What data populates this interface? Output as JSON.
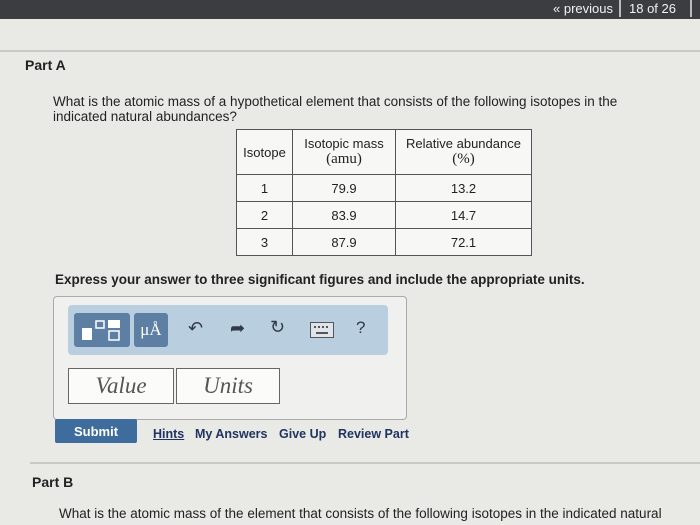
{
  "nav": {
    "previous_label": "« previous",
    "position": "18 of 26"
  },
  "part_a": {
    "title": "Part A",
    "question_line1": "What is the atomic mass of a hypothetical element that consists of the following isotopes in the",
    "question_line2": "indicated natural abundances?",
    "table": {
      "headers": {
        "isotope": "Isotope",
        "mass_line1": "Isotopic mass",
        "mass_line2": "(amu)",
        "abund_line1": "Relative abundance",
        "abund_line2": "(%)"
      },
      "rows": [
        {
          "isotope": "1",
          "mass": "79.9",
          "abundance": "13.2"
        },
        {
          "isotope": "2",
          "mass": "83.9",
          "abundance": "14.7"
        },
        {
          "isotope": "3",
          "mass": "87.9",
          "abundance": "72.1"
        }
      ]
    },
    "instruction": "Express your answer to three significant figures and include the appropriate units.",
    "toolbar": {
      "units_label": "μÅ",
      "help_label": "?"
    },
    "value_placeholder": "Value",
    "units_placeholder": "Units",
    "actions": {
      "submit": "Submit",
      "hints": "Hints",
      "my_answers": "My Answers",
      "give_up": "Give Up",
      "review_part": "Review Part"
    }
  },
  "part_b": {
    "title": "Part B",
    "question_line1": "What is the atomic mass of the element that consists of the following isotopes in the indicated natural"
  }
}
